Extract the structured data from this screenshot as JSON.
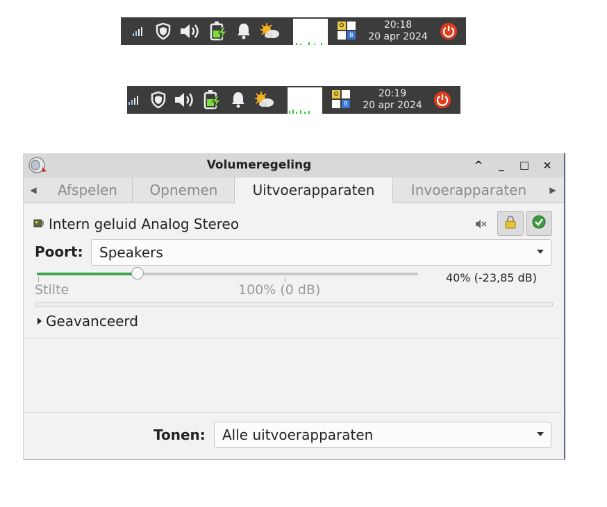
{
  "taskbars": [
    {
      "time": "20:18",
      "date": "20 apr 2024",
      "pager_labels": [
        "O",
        "",
        "",
        "B"
      ]
    },
    {
      "time": "20:19",
      "date": "20 apr 2024",
      "pager_labels": [
        "O",
        "",
        "",
        "B"
      ]
    }
  ],
  "icons": {
    "network": "signal-bars-icon",
    "shield": "shield-icon",
    "volume": "speaker-volume-icon",
    "battery": "battery-charging-icon",
    "notifications": "bell-icon",
    "weather": "sun-cloud-icon",
    "power": "power-icon"
  },
  "window": {
    "title": "Volumeregeling",
    "controls": {
      "keep_above": "^",
      "minimize": "_",
      "maximize": "□",
      "close": "×"
    }
  },
  "tabs": [
    "Afspelen",
    "Opnemen",
    "Uitvoerapparaten",
    "Invoerapparaten"
  ],
  "active_tab": "Uitvoerapparaten",
  "device": {
    "name": "Intern geluid Analog Stereo",
    "port_label": "Poort:",
    "port_value": "Speakers",
    "volume_fraction": 0.4,
    "volume_text": "40% (-23,85 dB)",
    "scale_marks": {
      "silence": "Stilte",
      "full": "100% (0 dB)"
    }
  },
  "advanced": {
    "label": "Geavanceerd"
  },
  "footer": {
    "label": "Tonen:",
    "value": "Alle uitvoerapparaten"
  },
  "colors": {
    "accent_green": "#3fa64a",
    "taskbar_bg": "#3c3c3c",
    "power_red": "#e03c1c",
    "pager_blue": "#3a78d8"
  }
}
